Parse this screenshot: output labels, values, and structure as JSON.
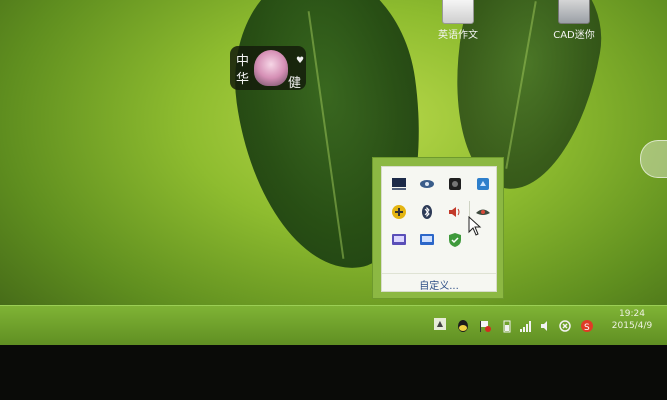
{
  "desktop": {
    "icons": [
      {
        "label": "英语作文"
      },
      {
        "label": "CAD迷你"
      }
    ],
    "widget": {
      "chars": [
        "中",
        "华",
        "健"
      ],
      "heart": "♥"
    }
  },
  "tray_popup": {
    "icons": [
      "monitor-icon",
      "network-icon",
      "app-icon",
      "blue-app-icon",
      "security-icon",
      "bluetooth-icon",
      "volume-icon",
      "eye-icon",
      "display-icon",
      "screen-icon",
      "shield-icon"
    ],
    "customize_label": "自定义..."
  },
  "taskbar": {
    "show_hidden_label": "▲",
    "tray_icons": [
      "qq-icon",
      "flag-icon",
      "battery-icon",
      "signal-icon",
      "speaker-icon",
      "close-circle-icon",
      "sogou-icon"
    ],
    "clock": {
      "time": "19:24",
      "date": "2015/4/9"
    }
  }
}
